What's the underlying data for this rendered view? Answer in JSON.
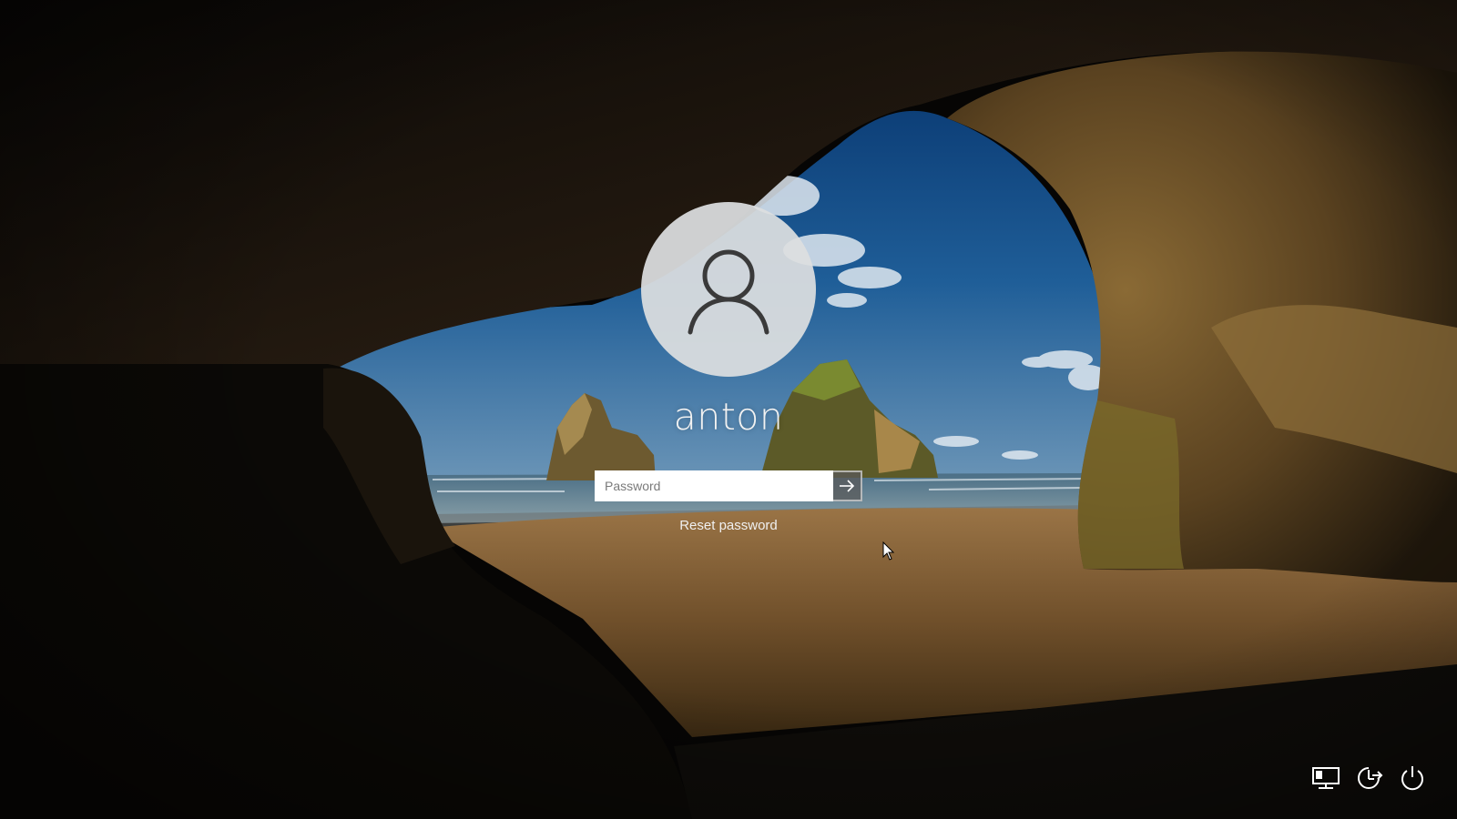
{
  "user": {
    "name": "anton",
    "avatar_icon": "person-icon"
  },
  "password": {
    "placeholder": "Password",
    "value": "",
    "submit_icon": "arrow-right-icon"
  },
  "reset_password_label": "Reset password",
  "system_buttons": [
    {
      "icon": "network-icon"
    },
    {
      "icon": "ease-of-access-icon"
    },
    {
      "icon": "power-icon"
    }
  ],
  "background": {
    "scene": "sea-cave-beach-wallpaper"
  }
}
